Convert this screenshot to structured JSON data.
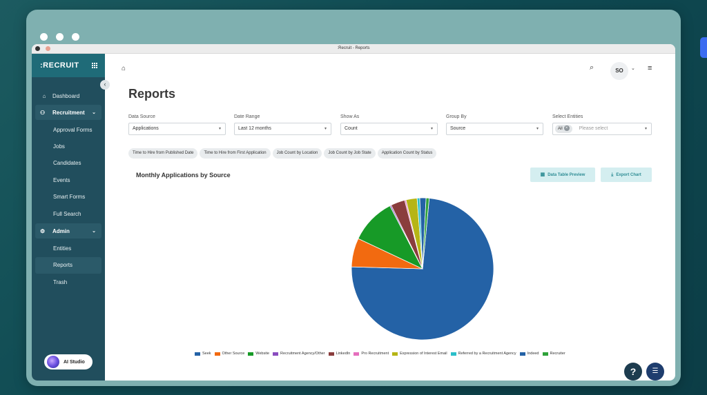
{
  "window": {
    "title": ":Recruit - Reports"
  },
  "sidebar": {
    "logo": ":RECRUIT",
    "items": [
      {
        "label": "Dashboard",
        "icon": "home-icon"
      }
    ],
    "sections": [
      {
        "label": "Recruitment",
        "icon": "people-icon",
        "children": [
          "Approval Forms",
          "Jobs",
          "Candidates",
          "Events",
          "Smart Forms",
          "Full Search"
        ]
      },
      {
        "label": "Admin",
        "icon": "admin-icon",
        "children": [
          "Entities",
          "Reports",
          "Trash"
        ]
      }
    ],
    "active_item": "Reports",
    "ai_studio_label": "AI Studio"
  },
  "header": {
    "avatar_initials": "SO"
  },
  "page": {
    "title": "Reports"
  },
  "filters": {
    "data_source": {
      "label": "Data Source",
      "value": "Applications"
    },
    "date_range": {
      "label": "Date Range",
      "value": "Last 12 months"
    },
    "show_as": {
      "label": "Show As",
      "value": "Count"
    },
    "group_by": {
      "label": "Group By",
      "value": "Source"
    },
    "select_entities": {
      "label": "Select Entities",
      "chip": "All",
      "placeholder": "Please select"
    }
  },
  "quick_reports": [
    "Time to Hire from Published Date",
    "Time to Hire from First Application",
    "Job Count by Location",
    "Job Count by Job State",
    "Application Count by Status"
  ],
  "chart_panel": {
    "data_table_label": "Data Table Preview",
    "export_label": "Export Chart"
  },
  "chart_data": {
    "type": "pie",
    "title": "Monthly Applications by Source",
    "legend_position": "bottom",
    "slices": [
      {
        "label": "Seek",
        "value": 73.2,
        "color": "#2462a6"
      },
      {
        "label": "Other Source",
        "value": 6.5,
        "color": "#f26a10"
      },
      {
        "label": "Website",
        "value": 10.3,
        "color": "#179a27"
      },
      {
        "label": "Recruitment Agency/Other",
        "value": 0.3,
        "color": "#8a4dbf"
      },
      {
        "label": "LinkedIn",
        "value": 3.2,
        "color": "#8a3d3d"
      },
      {
        "label": "Pro Recruitment",
        "value": 0.3,
        "color": "#e56fbd"
      },
      {
        "label": "Expression of Interest Email",
        "value": 2.5,
        "color": "#b6b515"
      },
      {
        "label": "Referred by a Recruitment Agency",
        "value": 0.6,
        "color": "#2bbfca"
      },
      {
        "label": "Indeed",
        "value": 1.4,
        "color": "#2462a6"
      },
      {
        "label": "Recruiter",
        "value": 0.7,
        "color": "#2fa23a"
      }
    ]
  }
}
